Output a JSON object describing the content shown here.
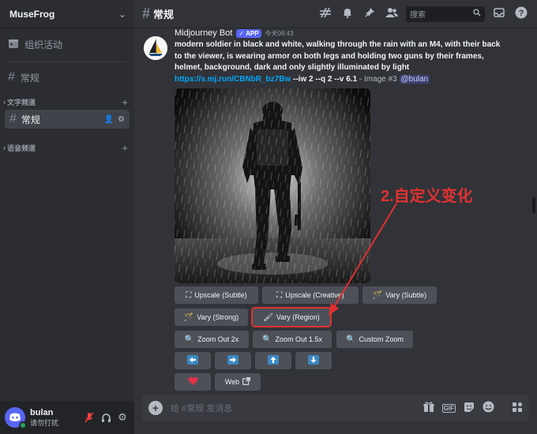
{
  "server": {
    "name": "MuseFrog"
  },
  "sidebar": {
    "events_label": "组织活动",
    "top_channel": "常规",
    "text_category": "文字频道",
    "active_channel": "常规",
    "voice_category": "语音频道"
  },
  "user": {
    "name": "bulan",
    "status": "请勿打扰",
    "avatar_initial": "☺"
  },
  "topbar": {
    "channel_name": "常规",
    "search_placeholder": "搜索"
  },
  "message": {
    "bot_name": "Midjourney Bot",
    "app_badge": "APP",
    "timestamp": "今天06:43",
    "prompt": "modern soldier in black and white, walking through the rain with an M4, with their back to the viewer, is wearing armor on both legs and holding two guns by their frames, helmet, background, dark and only slightly illuminated by light ",
    "link": "https://s.mj.run/CBNbR_bz7Bw",
    "params": " --iw 2 --q 2 --v 6.1",
    "image_tag": " - Image #3 ",
    "mention": "@bulan"
  },
  "buttons": {
    "upscale_subtle": "Upscale (Subtle)",
    "upscale_creative": "Upscale (Creative)",
    "vary_subtle": "Vary (Subtle)",
    "vary_strong": "Vary (Strong)",
    "vary_region": "Vary (Region)",
    "zoom_out_2x": "Zoom Out 2x",
    "zoom_out_1_5x": "Zoom Out 1.5x",
    "custom_zoom": "Custom Zoom",
    "web": "Web"
  },
  "annotation": {
    "text": "2.自定义变化",
    "color": "#e03131"
  },
  "composer": {
    "placeholder": "给 #常规 发消息"
  },
  "colors": {
    "accent": "#5865f2",
    "link": "#00a8fc",
    "annotation": "#e03131",
    "status_online": "#23a55a"
  }
}
